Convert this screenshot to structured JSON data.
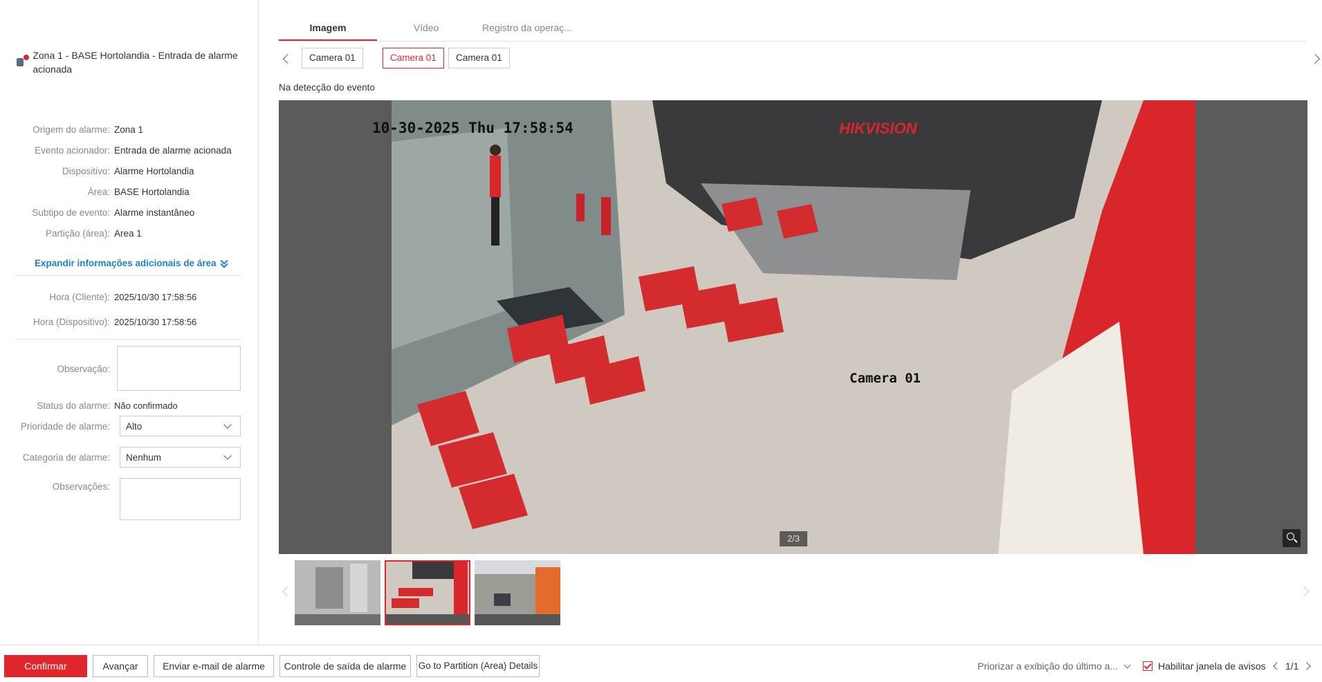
{
  "alarm": {
    "title": "Zona 1 - BASE Hortolandia - Entrada de alarme acionada"
  },
  "details": [
    {
      "label": "Origem do alarme:",
      "value": "Zona 1"
    },
    {
      "label": "Evento acionador:",
      "value": "Entrada de alarme acionada"
    },
    {
      "label": "Dispositivo:",
      "value": "Alarme Hortolandia"
    },
    {
      "label": "Área:",
      "value": "BASE Hortolandia"
    },
    {
      "label": "Subtipo de evento:",
      "value": "Alarme instantâneo"
    },
    {
      "label": "Partição (área):",
      "value": "Area 1"
    }
  ],
  "expand_label": "Expandir informações adicionais de área",
  "times": [
    {
      "label": "Hora (Cliente):",
      "value": "2025/10/30 17:58:56"
    },
    {
      "label": "Hora (Dispositivo):",
      "value": "2025/10/30 17:58:56"
    }
  ],
  "form": {
    "observacao_label": "Observação:",
    "observacao_value": "",
    "status_label": "Status do alarme:",
    "status_value": "Não confirmado",
    "priority_label": "Prioridade de alarme:",
    "priority_value": "Alto",
    "category_label": "Categoria de alarme:",
    "category_value": "Nenhum",
    "remarks_label": "Observações:",
    "remarks_value": ""
  },
  "tabs": [
    "Imagem",
    "Vídeo",
    "Registro da operaç..."
  ],
  "cameras": [
    "Camera 01",
    "Camera 01",
    "Camera 01"
  ],
  "active_camera": 1,
  "event_label": "Na detecção do evento",
  "image": {
    "timestamp": "10-30-2025 Thu 17:58:54",
    "brand": "HIKVISION",
    "camera_overlay": "Camera 01",
    "counter": "2/3"
  },
  "footer": {
    "confirm": "Confirmar",
    "next": "Avançar",
    "email": "Enviar e-mail de alarme",
    "output": "Controle de saída de alarme",
    "partition": "Go to Partition (Area) Details",
    "prioritize": "Priorizar a exibição do último a...",
    "enable_popup": "Habilitar janela de avisos",
    "page": "1/1"
  },
  "colors": {
    "accent": "#e0262d",
    "link": "#1b82d2"
  }
}
